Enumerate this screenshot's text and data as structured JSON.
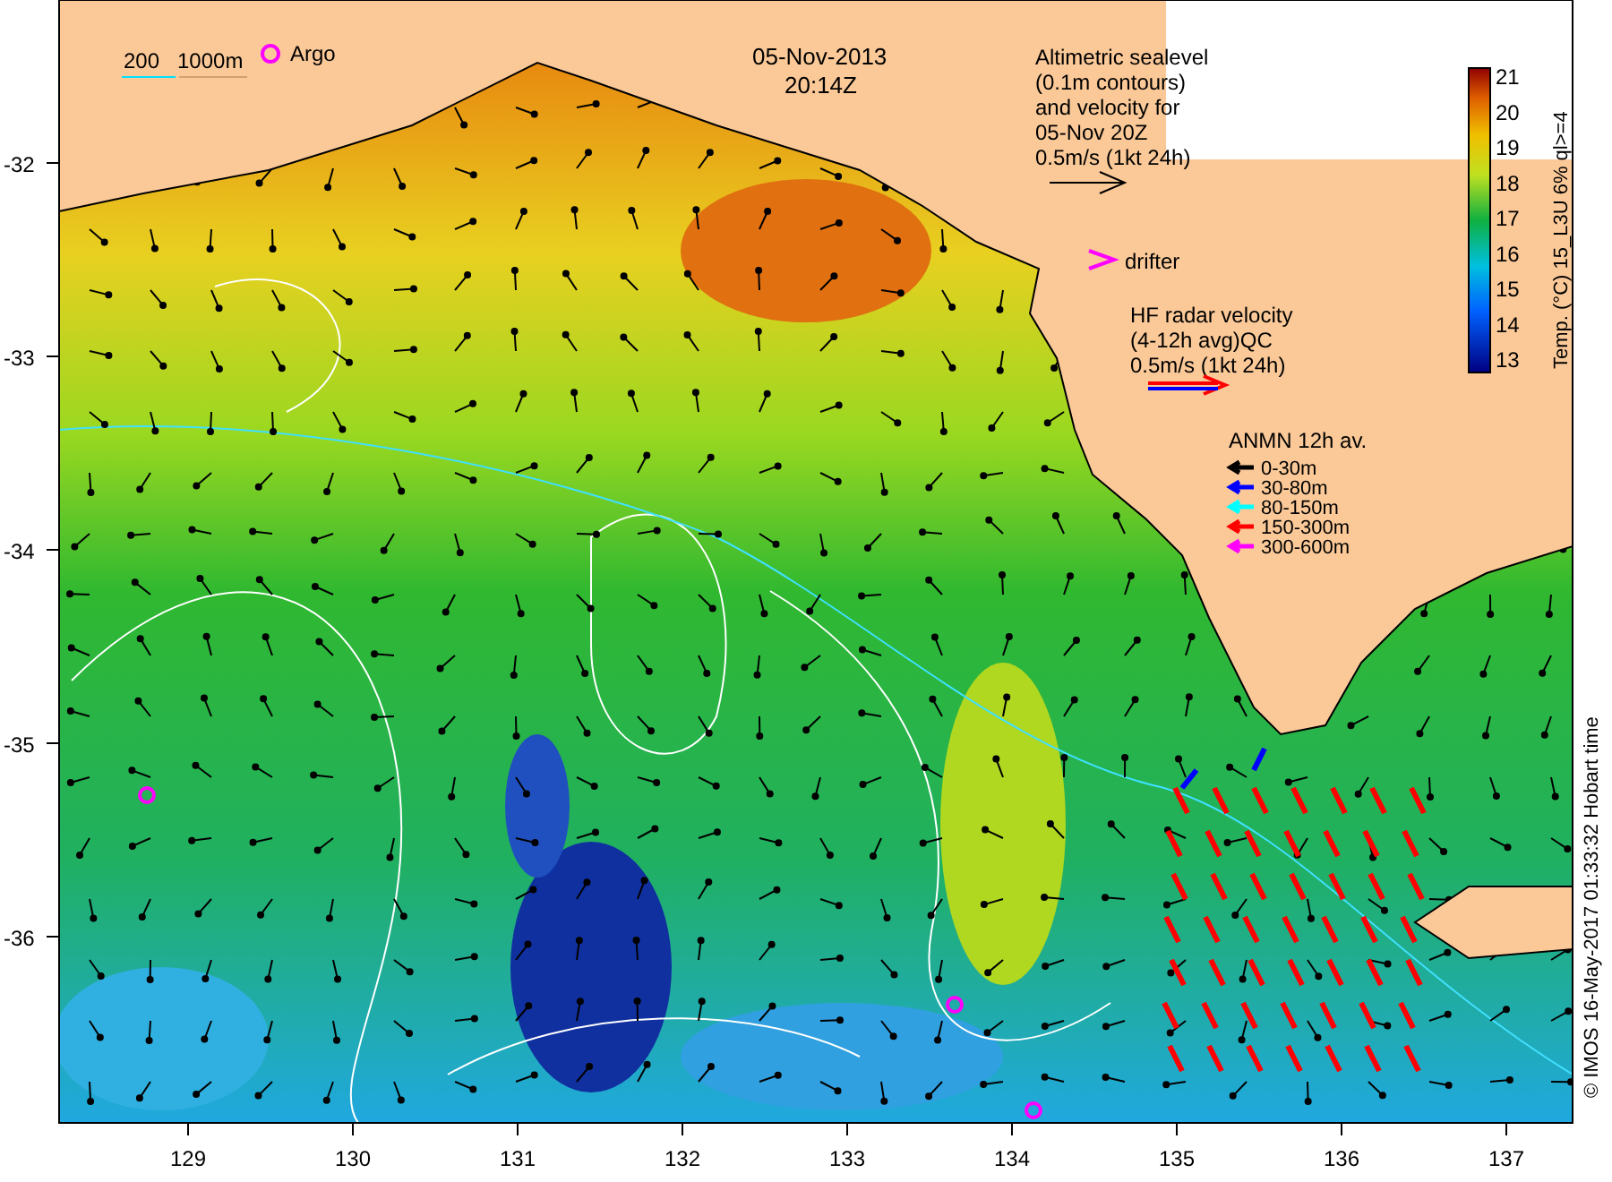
{
  "map": {
    "title_date": "05-Nov-2013",
    "title_time": "20:14Z",
    "depth_scale": [
      "200",
      "1000m"
    ],
    "argo_label": "Argo",
    "altimetry_legend": [
      "Altimetric sealevel",
      "(0.1m contours)",
      "and velocity for",
      "05-Nov 20Z",
      "0.5m/s (1kt 24h)"
    ],
    "drifter_label": "drifter",
    "radar_legend": [
      "HF radar velocity",
      "(4-12h avg)QC",
      "0.5m/s (1kt 24h)"
    ],
    "anmn_legend": {
      "title": "ANMN 12h av.",
      "items": [
        {
          "label": "0-30m",
          "color": "#000000"
        },
        {
          "label": "30-80m",
          "color": "#0000ff"
        },
        {
          "label": "80-150m",
          "color": "#00ffff"
        },
        {
          "label": "150-300m",
          "color": "#ff0000"
        },
        {
          "label": "300-600m",
          "color": "#ff00ff"
        }
      ]
    },
    "colorbar": {
      "label": "Temp. (°C) 15_L3U 6% ql>=4",
      "ticks": [
        "21",
        "20",
        "19",
        "18",
        "17",
        "16",
        "15",
        "14",
        "13"
      ]
    },
    "credit": "© IMOS 16-May-2017 01:33:32 Hobart time",
    "x_ticks": [
      "129",
      "130",
      "131",
      "132",
      "133",
      "134",
      "135",
      "136",
      "137"
    ],
    "y_ticks": [
      "-32",
      "-33",
      "-34",
      "-35",
      "-36"
    ]
  }
}
